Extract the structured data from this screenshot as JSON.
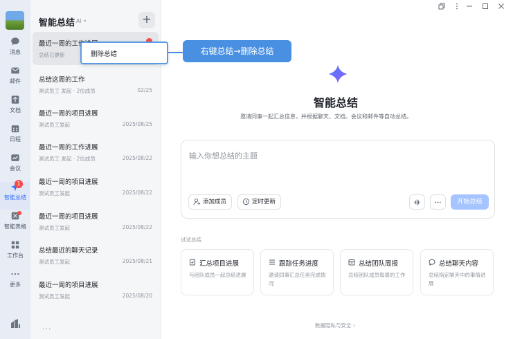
{
  "rail": {
    "items": [
      {
        "label": "消息",
        "icon": "chat-bubble-icon"
      },
      {
        "label": "邮件",
        "icon": "mail-icon"
      },
      {
        "label": "文档",
        "icon": "document-icon"
      },
      {
        "label": "日程",
        "icon": "calendar-icon"
      },
      {
        "label": "会议",
        "icon": "video-meeting-icon"
      },
      {
        "label": "智能总结",
        "icon": "sparkle-icon",
        "badge": "1"
      },
      {
        "label": "智能表格",
        "icon": "grid-table-icon"
      },
      {
        "label": "工作台",
        "icon": "apps-grid-icon"
      },
      {
        "label": "更多",
        "icon": "more-dots-icon"
      }
    ]
  },
  "panel": {
    "title": "智能总结",
    "ai_tag": "AI •",
    "add_label": "+",
    "items": [
      {
        "title": "最近一周的工作进展",
        "sub": "总结已更新",
        "date": ""
      },
      {
        "title": "总结这周的工作",
        "sub": "测试员工 发起 · 2位成员",
        "date": "02/25"
      },
      {
        "title": "最近一周的项目进展",
        "sub": "测试员工发起",
        "date": "2025/08/25"
      },
      {
        "title": "最近一周的工作进展",
        "sub": "测试员工 发起 · 2位成员",
        "date": "2025/08/22"
      },
      {
        "title": "最近一周的项目进展",
        "sub": "测试员工发起",
        "date": "2025/08/22"
      },
      {
        "title": "最近一周的项目进展",
        "sub": "测试员工发起",
        "date": "2025/08/22"
      },
      {
        "title": "总结最近的聊天记录",
        "sub": "测试员工发起",
        "date": "2025/08/21"
      },
      {
        "title": "最近一周的项目进展",
        "sub": "测试员工发起",
        "date": "2025/08/20"
      }
    ],
    "more": "..."
  },
  "context_menu": {
    "option": "删除总结"
  },
  "callout": {
    "text": "右键总结→删除总结"
  },
  "main": {
    "title": "智能总结",
    "subtitle": "邀请同事一起汇总信息，并根据聊天、文档、会议和邮件等自动总结。",
    "input_placeholder": "输入你想总结的主题",
    "add_member": "添加成员",
    "scheduled_update": "定时更新",
    "start": "开始总结",
    "try_label": "试试总结",
    "cards": [
      {
        "title": "汇总项目进展",
        "desc": "与团队成员一起总结进展",
        "icon": "doc-check-icon"
      },
      {
        "title": "跟踪任务进度",
        "desc": "邀请同事汇总任务完成情况",
        "icon": "list-lines-icon"
      },
      {
        "title": "总结团队周报",
        "desc": "总结团队成员每周的工作",
        "icon": "calendar-icon"
      },
      {
        "title": "总结聊天内容",
        "desc": "总结指定聊天中的事情进展",
        "icon": "chat-bubble-icon"
      }
    ],
    "privacy": "数据隐私与安全 ›"
  },
  "colors": {
    "accent": "#3370ff",
    "callout": "#4a90e2",
    "start_disabled": "#a6c4ff",
    "badge": "#f54a45"
  }
}
